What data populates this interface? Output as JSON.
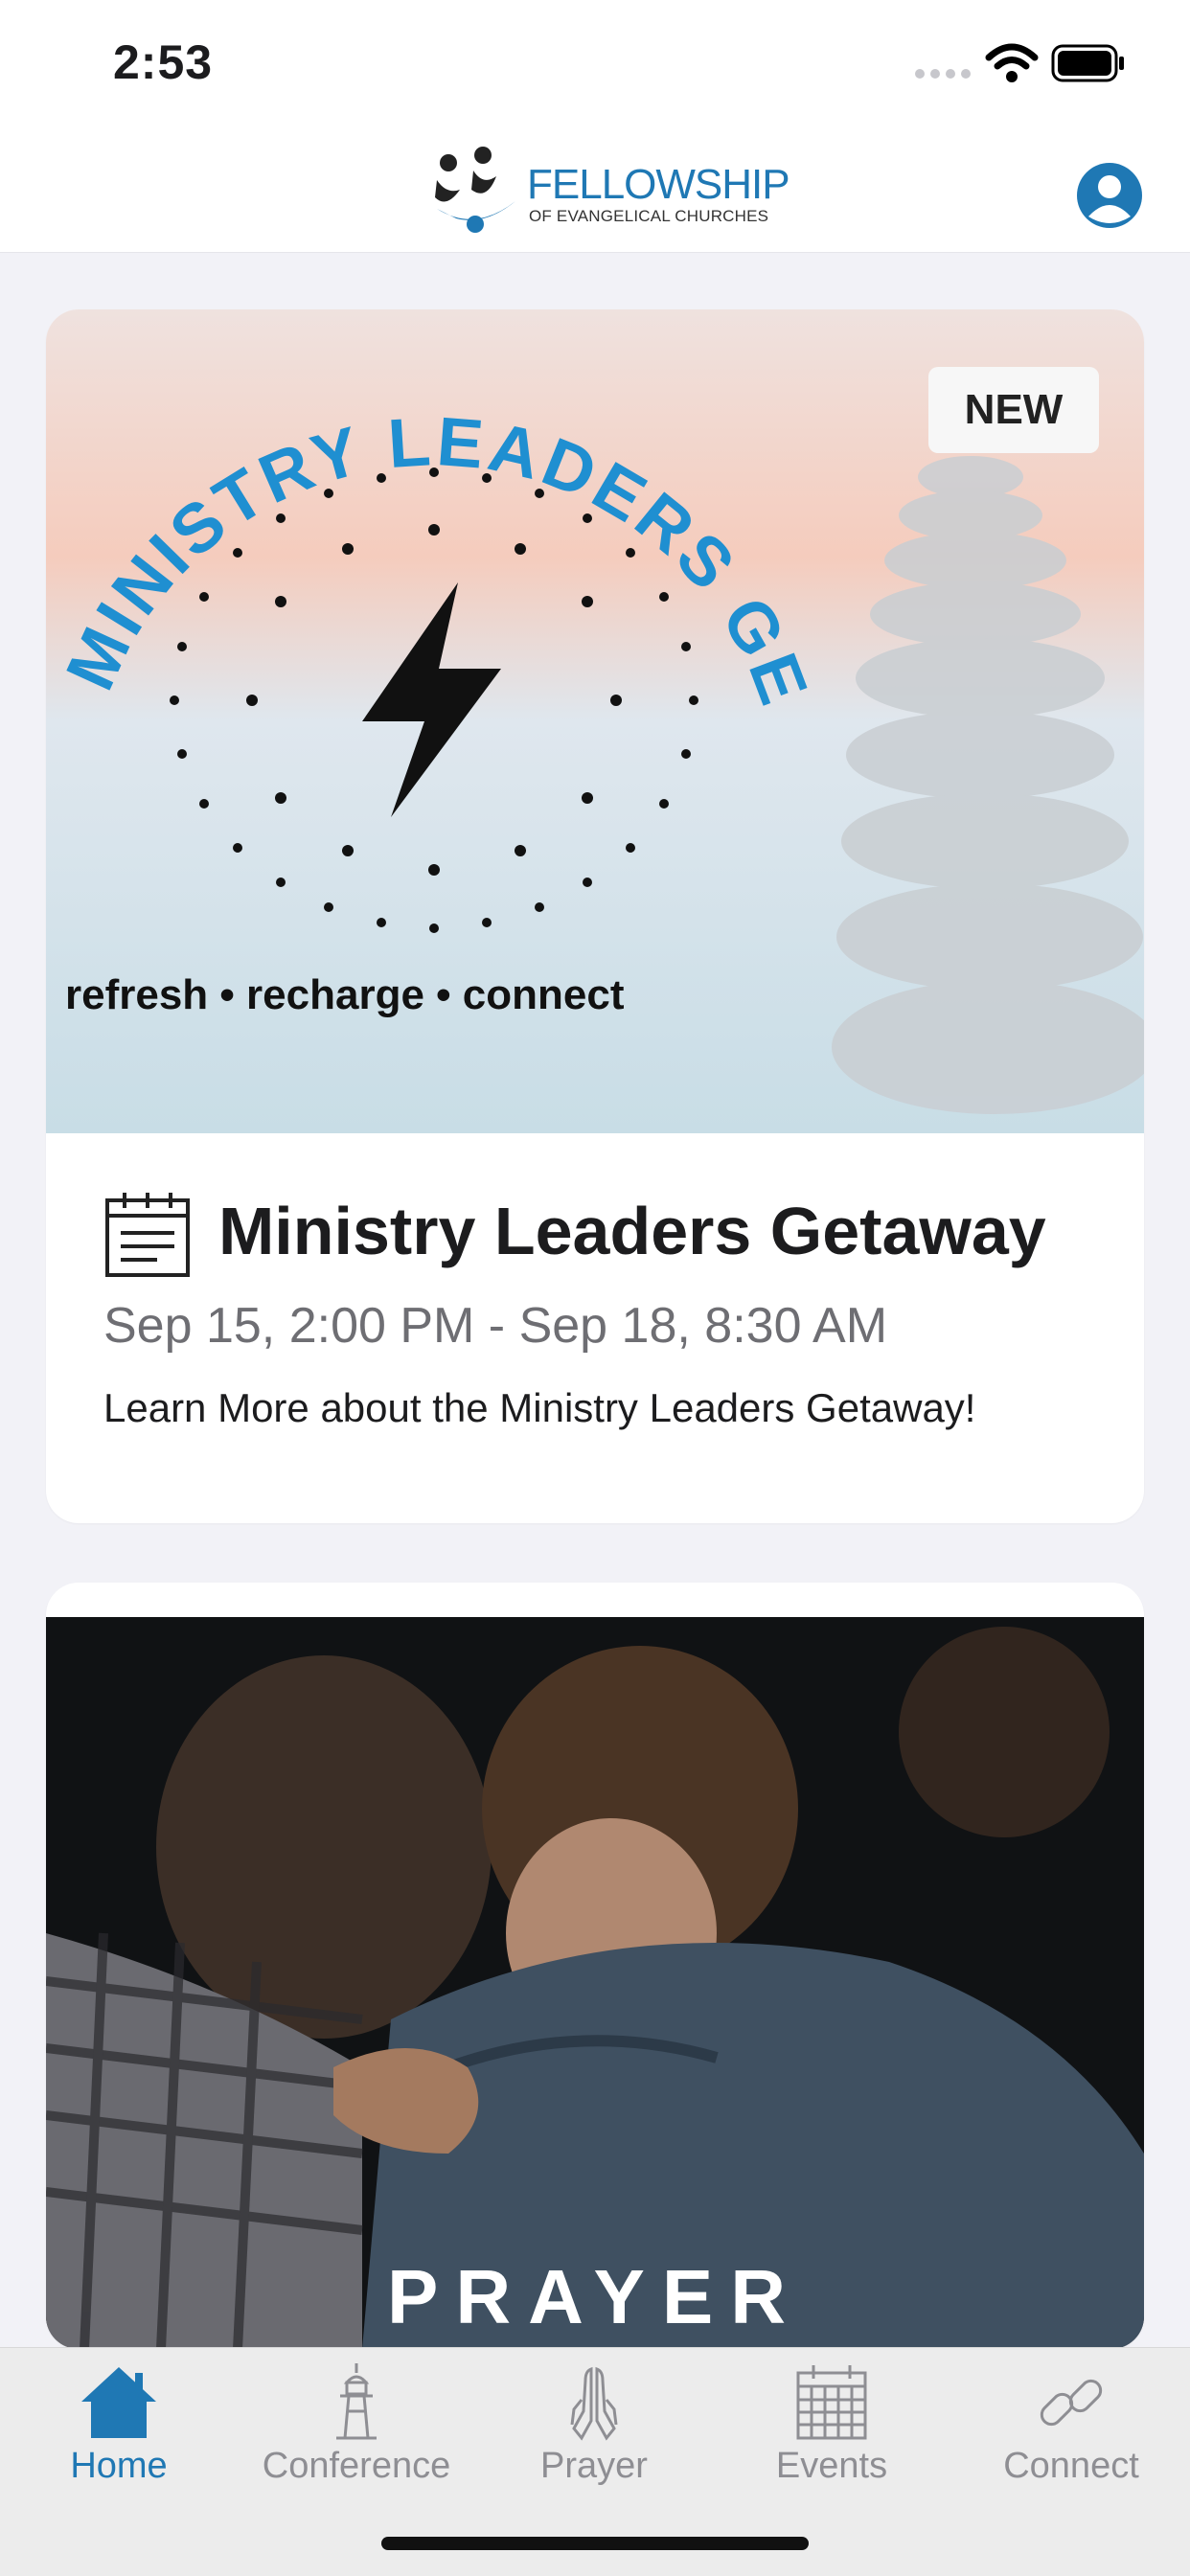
{
  "status_bar": {
    "time": "2:53"
  },
  "header": {
    "logo_main": "FELLOWSHIP",
    "logo_sub": "OF EVANGELICAL CHURCHES",
    "profile_icon": "user-circle-icon"
  },
  "feed": [
    {
      "badge": "NEW",
      "image_title": "MINISTRY LEADERS GETAWAY",
      "image_tagline": "refresh • recharge • connect",
      "icon": "calendar-note-icon",
      "title": "Ministry Leaders Getaway",
      "date": "Sep 15, 2:00 PM - Sep 18, 8:30 AM",
      "description": "Learn More about the Ministry Leaders Getaway!"
    },
    {
      "image_caption": "PRAYER"
    }
  ],
  "tabs": [
    {
      "label": "Home",
      "icon": "home-icon",
      "active": true
    },
    {
      "label": "Conference",
      "icon": "lighthouse-icon",
      "active": false
    },
    {
      "label": "Prayer",
      "icon": "praying-hands-icon",
      "active": false
    },
    {
      "label": "Events",
      "icon": "calendar-icon",
      "active": false
    },
    {
      "label": "Connect",
      "icon": "link-icon",
      "active": false
    }
  ],
  "colors": {
    "accent": "#1f78b4",
    "inactive": "#8e8e93",
    "background": "#f2f2f7"
  }
}
